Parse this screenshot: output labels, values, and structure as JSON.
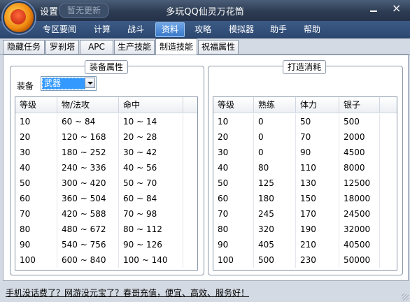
{
  "titlebar": {
    "settings_label": "设置",
    "update_label": "暂无更新",
    "title": "多玩QQ仙灵万花筒",
    "minimize_label": "",
    "close_label": "×"
  },
  "menu": [
    "专区要闻",
    "计算",
    "战斗",
    "资料",
    "攻略",
    "模拟器",
    "助手",
    "帮助"
  ],
  "menu_active": "资料",
  "tabs": [
    "隐藏任务",
    "罗刹塔",
    "APC",
    "生产技能",
    "制造技能",
    "祝福属性"
  ],
  "tab_active": "制造技能",
  "equip_panel": {
    "title": "装备属性",
    "equip_label": "装备",
    "equip_value": "武器",
    "columns": [
      "等级",
      "物/法攻",
      "命中"
    ],
    "rows": [
      [
        "10",
        "60 ~ 84",
        "10 ~ 14"
      ],
      [
        "20",
        "120 ~ 168",
        "20 ~ 28"
      ],
      [
        "30",
        "180 ~ 252",
        "30 ~ 42"
      ],
      [
        "40",
        "240 ~ 336",
        "40 ~ 56"
      ],
      [
        "50",
        "300 ~ 420",
        "50 ~ 70"
      ],
      [
        "60",
        "360 ~ 504",
        "60 ~ 84"
      ],
      [
        "70",
        "420 ~ 588",
        "70 ~ 98"
      ],
      [
        "80",
        "480 ~ 672",
        "80 ~ 112"
      ],
      [
        "90",
        "540 ~ 756",
        "90 ~ 126"
      ],
      [
        "100",
        "600 ~ 840",
        "100 ~ 140"
      ]
    ]
  },
  "cost_panel": {
    "title": "打造消耗",
    "columns": [
      "等级",
      "熟练",
      "体力",
      "银子"
    ],
    "rows": [
      [
        "10",
        "0",
        "50",
        "500"
      ],
      [
        "20",
        "0",
        "70",
        "2000"
      ],
      [
        "30",
        "0",
        "90",
        "4500"
      ],
      [
        "40",
        "80",
        "110",
        "8000"
      ],
      [
        "50",
        "125",
        "130",
        "12500"
      ],
      [
        "60",
        "180",
        "150",
        "18000"
      ],
      [
        "70",
        "245",
        "170",
        "24500"
      ],
      [
        "80",
        "320",
        "190",
        "32000"
      ],
      [
        "90",
        "405",
        "210",
        "40500"
      ],
      [
        "100",
        "500",
        "230",
        "50000"
      ]
    ]
  },
  "footer_link": "手机没话费了？网游没元宝了？春哥充值，便宜、高效、服务好！",
  "colors": {
    "titlebar": "#2d3c52",
    "menubar": "#2c4870",
    "menu_active": "#3a78c8",
    "selection": "#3399ff"
  }
}
